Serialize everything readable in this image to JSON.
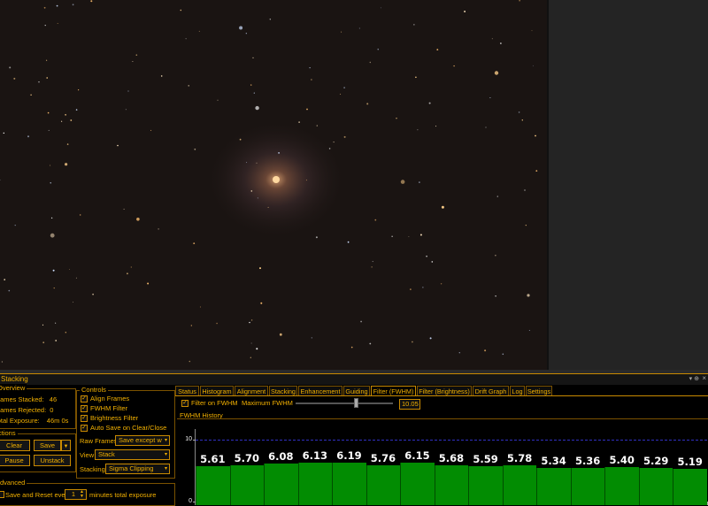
{
  "panel": {
    "title": "Stacking"
  },
  "overview": {
    "title": "Overview",
    "frames_stacked_label": "Frames Stacked:",
    "frames_stacked": "46",
    "frames_rejected_label": "Frames Rejected:",
    "frames_rejected": "0",
    "total_exposure_label": "Total Exposure:",
    "total_exposure": "46m 0s"
  },
  "actions": {
    "title": "Actions",
    "clear": "Clear",
    "save": "Save",
    "pause": "Pause",
    "unstack": "Unstack"
  },
  "controls": {
    "title": "Controls",
    "align_frames": "Align Frames",
    "fwhm_filter": "FWHM Filter",
    "brightness_filter": "Brightness Filter",
    "auto_save": "Auto Save on Clear/Close",
    "raw_frames_label": "Raw Frames",
    "raw_frames_value": "Save except w",
    "view_label": "View",
    "view_value": "Stack",
    "stacking_label": "Stacking",
    "stacking_value": "Sigma Clipping"
  },
  "advanced": {
    "title": "Advanced",
    "save_reset_label": "Save and Reset every",
    "save_reset_value": "1",
    "save_reset_suffix": "minutes total exposure"
  },
  "tabs": [
    "Status",
    "Histogram",
    "Alignment",
    "Stacking",
    "Enhancement",
    "Guiding",
    "Filter (FWHM)",
    "Filter (Brightness)",
    "Drift Graph",
    "Log",
    "Settings"
  ],
  "active_tab": "Filter (FWHM)",
  "fwhm": {
    "filter_label": "Filter on FWHM",
    "filter_checked": true,
    "max_label": "Maximum FWHM",
    "max_value": "10.05",
    "slider_fraction": 0.62,
    "history_title": "FWHM History"
  },
  "chart_data": {
    "type": "bar",
    "title": "FWHM History",
    "threshold": 10,
    "ylim": [
      0,
      10
    ],
    "yticks": [
      "10",
      "0"
    ],
    "values": [
      5.61,
      5.7,
      6.08,
      6.13,
      6.19,
      5.76,
      6.15,
      5.68,
      5.59,
      5.78,
      5.34,
      5.36,
      5.4,
      5.29,
      5.19
    ],
    "labels": [
      "5.61",
      "5.70",
      "6.08",
      "6.13",
      "6.19",
      "5.76",
      "6.15",
      "5.68",
      "5.59",
      "5.78",
      "5.34",
      "5.36",
      "5.40",
      "5.29",
      "5.19"
    ],
    "bar_color": "#028c02",
    "threshold_color": "#3030c0"
  }
}
